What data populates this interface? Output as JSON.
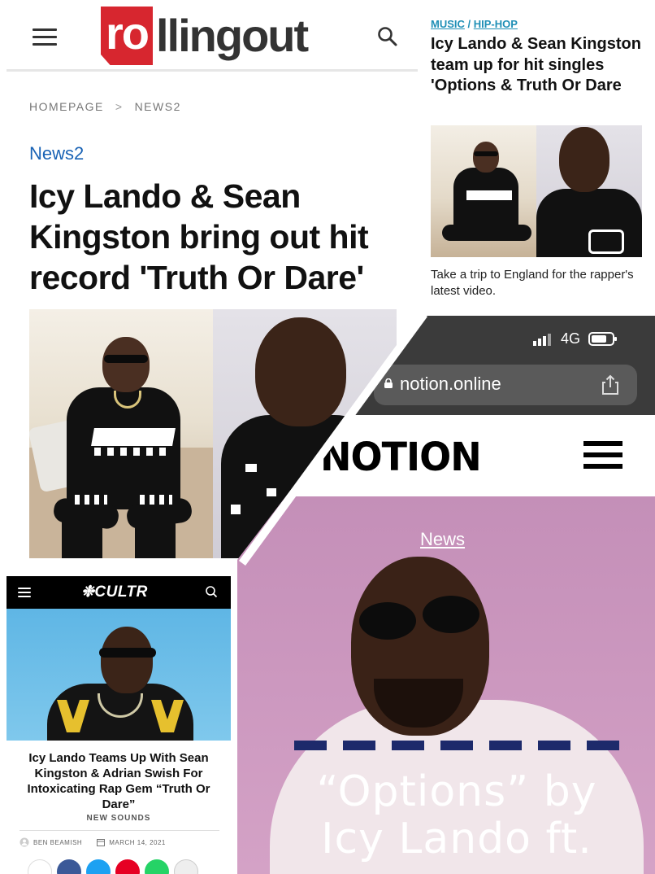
{
  "rollingout": {
    "logo_red": "ro",
    "logo_rest": "llingout",
    "breadcrumb": [
      "HOMEPAGE",
      "NEWS2"
    ],
    "breadcrumb_sep": ">",
    "category": "News2",
    "title": "Icy Lando & Sean Kingston bring out hit record 'Truth Or Dare'",
    "icons": [
      "hamburger-menu-icon",
      "search-icon"
    ],
    "colors": {
      "brand_red": "#d7262f",
      "category_blue": "#1a63b5"
    }
  },
  "article_card": {
    "category_1": "MUSIC",
    "category_sep": "/",
    "category_2": "HIP-HOP",
    "title": "Icy Lando & Sean Kingston team up for hit singles 'Options & Truth Or Dare",
    "caption": "Take a trip to England for the rapper's latest video.",
    "colors": {
      "category_teal": "#1f8fb6"
    }
  },
  "notion": {
    "status_network": "4G",
    "url": "notion.online",
    "logo": "NOTION",
    "tag": "News",
    "headline_line1": "“Options” by",
    "headline_line2": "Icy Lando ft.",
    "icons": [
      "signal-icon",
      "battery-icon",
      "lock-icon",
      "share-icon",
      "hamburger-menu-icon"
    ],
    "colors": {
      "status_bar": "#3b3b3b",
      "hero_pink": "#c48fb8"
    }
  },
  "cultr": {
    "logo": "CULTR",
    "title": "Icy Lando Teams Up With Sean Kingston & Adrian Swish For Intoxicating Rap Gem “Truth Or Dare”",
    "section": "NEW SOUNDS",
    "author": "BEN BEAMISH",
    "date": "MARCH 14, 2021",
    "icons": [
      "hamburger-menu-icon",
      "search-icon",
      "author-icon",
      "calendar-icon"
    ],
    "share_colors": [
      "#3b5998",
      "#1da1f2",
      "#e60023",
      "#25d366",
      "#eeeeee"
    ]
  }
}
